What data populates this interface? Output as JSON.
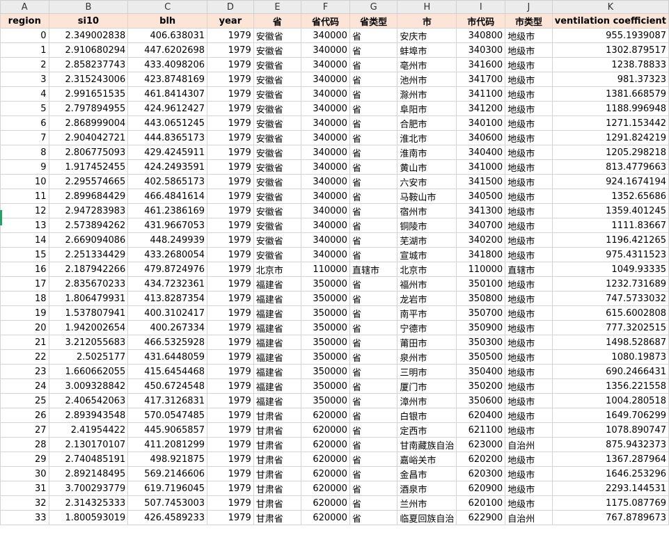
{
  "column_letters": [
    "A",
    "B",
    "C",
    "D",
    "E",
    "F",
    "G",
    "H",
    "I",
    "J",
    "K"
  ],
  "headers": [
    "region",
    "si10",
    "blh",
    "year",
    "省",
    "省代码",
    "省类型",
    "市",
    "市代码",
    "市类型",
    "ventilation coefficient"
  ],
  "rows": [
    [
      "0",
      "2.349002838",
      "406.638031",
      "1979",
      "安徽省",
      "340000",
      "省",
      "安庆市",
      "340800",
      "地级市",
      "955.1939087"
    ],
    [
      "1",
      "2.910680294",
      "447.6202698",
      "1979",
      "安徽省",
      "340000",
      "省",
      "蚌埠市",
      "340300",
      "地级市",
      "1302.879517"
    ],
    [
      "2",
      "2.858237743",
      "433.4098206",
      "1979",
      "安徽省",
      "340000",
      "省",
      "亳州市",
      "341600",
      "地级市",
      "1238.78833"
    ],
    [
      "3",
      "2.315243006",
      "423.8748169",
      "1979",
      "安徽省",
      "340000",
      "省",
      "池州市",
      "341700",
      "地级市",
      "981.37323"
    ],
    [
      "4",
      "2.991651535",
      "461.8414307",
      "1979",
      "安徽省",
      "340000",
      "省",
      "滁州市",
      "341100",
      "地级市",
      "1381.668579"
    ],
    [
      "5",
      "2.797894955",
      "424.9612427",
      "1979",
      "安徽省",
      "340000",
      "省",
      "阜阳市",
      "341200",
      "地级市",
      "1188.996948"
    ],
    [
      "6",
      "2.868999004",
      "443.0651245",
      "1979",
      "安徽省",
      "340000",
      "省",
      "合肥市",
      "340100",
      "地级市",
      "1271.153442"
    ],
    [
      "7",
      "2.904042721",
      "444.8365173",
      "1979",
      "安徽省",
      "340000",
      "省",
      "淮北市",
      "340600",
      "地级市",
      "1291.824219"
    ],
    [
      "8",
      "2.806775093",
      "429.4245911",
      "1979",
      "安徽省",
      "340000",
      "省",
      "淮南市",
      "340400",
      "地级市",
      "1205.298218"
    ],
    [
      "9",
      "1.917452455",
      "424.2493591",
      "1979",
      "安徽省",
      "340000",
      "省",
      "黄山市",
      "341000",
      "地级市",
      "813.4779663"
    ],
    [
      "10",
      "2.295574665",
      "402.5865173",
      "1979",
      "安徽省",
      "340000",
      "省",
      "六安市",
      "341500",
      "地级市",
      "924.1674194"
    ],
    [
      "11",
      "2.899684429",
      "466.4841614",
      "1979",
      "安徽省",
      "340000",
      "省",
      "马鞍山市",
      "340500",
      "地级市",
      "1352.65686"
    ],
    [
      "12",
      "2.947283983",
      "461.2386169",
      "1979",
      "安徽省",
      "340000",
      "省",
      "宿州市",
      "341300",
      "地级市",
      "1359.401245"
    ],
    [
      "13",
      "2.573894262",
      "431.9667053",
      "1979",
      "安徽省",
      "340000",
      "省",
      "铜陵市",
      "340700",
      "地级市",
      "1111.83667"
    ],
    [
      "14",
      "2.669094086",
      "448.249939",
      "1979",
      "安徽省",
      "340000",
      "省",
      "芜湖市",
      "340200",
      "地级市",
      "1196.421265"
    ],
    [
      "15",
      "2.251334429",
      "433.2680054",
      "1979",
      "安徽省",
      "340000",
      "省",
      "宣城市",
      "341800",
      "地级市",
      "975.4311523"
    ],
    [
      "16",
      "2.187942266",
      "479.8724976",
      "1979",
      "北京市",
      "110000",
      "直辖市",
      "北京市",
      "110000",
      "直辖市",
      "1049.93335"
    ],
    [
      "17",
      "2.835670233",
      "434.7232361",
      "1979",
      "福建省",
      "350000",
      "省",
      "福州市",
      "350100",
      "地级市",
      "1232.731689"
    ],
    [
      "18",
      "1.806479931",
      "413.8287354",
      "1979",
      "福建省",
      "350000",
      "省",
      "龙岩市",
      "350800",
      "地级市",
      "747.5733032"
    ],
    [
      "19",
      "1.537807941",
      "400.3102417",
      "1979",
      "福建省",
      "350000",
      "省",
      "南平市",
      "350700",
      "地级市",
      "615.6002808"
    ],
    [
      "20",
      "1.942002654",
      "400.267334",
      "1979",
      "福建省",
      "350000",
      "省",
      "宁德市",
      "350900",
      "地级市",
      "777.3202515"
    ],
    [
      "21",
      "3.212055683",
      "466.5325928",
      "1979",
      "福建省",
      "350000",
      "省",
      "莆田市",
      "350300",
      "地级市",
      "1498.528687"
    ],
    [
      "22",
      "2.5025177",
      "431.6448059",
      "1979",
      "福建省",
      "350000",
      "省",
      "泉州市",
      "350500",
      "地级市",
      "1080.19873"
    ],
    [
      "23",
      "1.660662055",
      "415.6454468",
      "1979",
      "福建省",
      "350000",
      "省",
      "三明市",
      "350400",
      "地级市",
      "690.2466431"
    ],
    [
      "24",
      "3.009328842",
      "450.6724548",
      "1979",
      "福建省",
      "350000",
      "省",
      "厦门市",
      "350200",
      "地级市",
      "1356.221558"
    ],
    [
      "25",
      "2.406542063",
      "417.3126831",
      "1979",
      "福建省",
      "350000",
      "省",
      "漳州市",
      "350600",
      "地级市",
      "1004.280518"
    ],
    [
      "26",
      "2.893943548",
      "570.0547485",
      "1979",
      "甘肃省",
      "620000",
      "省",
      "白银市",
      "620400",
      "地级市",
      "1649.706299"
    ],
    [
      "27",
      "2.41954422",
      "445.9065857",
      "1979",
      "甘肃省",
      "620000",
      "省",
      "定西市",
      "621100",
      "地级市",
      "1078.890747"
    ],
    [
      "28",
      "2.130170107",
      "411.2081299",
      "1979",
      "甘肃省",
      "620000",
      "省",
      "甘南藏族自治",
      "623000",
      "自治州",
      "875.9432373"
    ],
    [
      "29",
      "2.740485191",
      "498.921875",
      "1979",
      "甘肃省",
      "620000",
      "省",
      "嘉峪关市",
      "620200",
      "地级市",
      "1367.287964"
    ],
    [
      "30",
      "2.892148495",
      "569.2146606",
      "1979",
      "甘肃省",
      "620000",
      "省",
      "金昌市",
      "620300",
      "地级市",
      "1646.253296"
    ],
    [
      "31",
      "3.700293779",
      "619.7196045",
      "1979",
      "甘肃省",
      "620000",
      "省",
      "酒泉市",
      "620900",
      "地级市",
      "2293.144531"
    ],
    [
      "32",
      "2.314325333",
      "507.7453003",
      "1979",
      "甘肃省",
      "620000",
      "省",
      "兰州市",
      "620100",
      "地级市",
      "1175.087769"
    ],
    [
      "33",
      "1.800593019",
      "426.4589233",
      "1979",
      "甘肃省",
      "620000",
      "省",
      "临夏回族自治",
      "622900",
      "自治州",
      "767.8789673"
    ]
  ]
}
